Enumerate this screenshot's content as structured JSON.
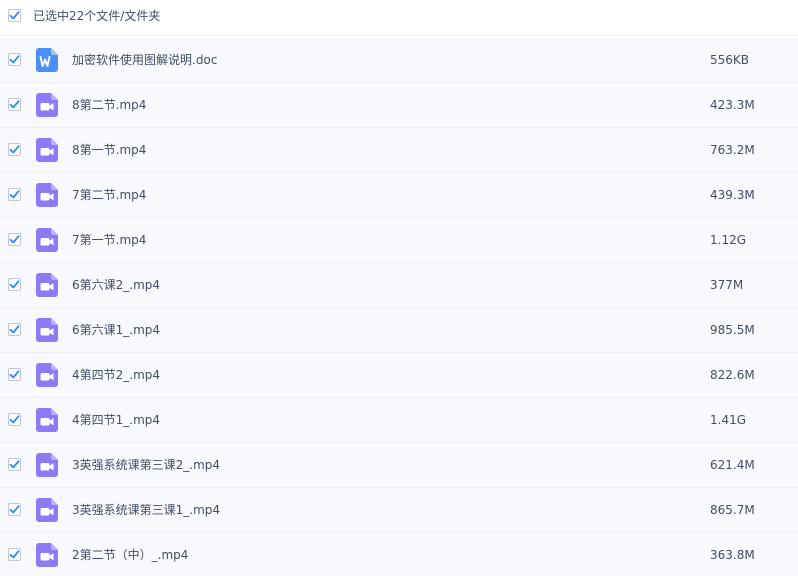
{
  "header": {
    "selection_text": "已选中22个文件/文件夹",
    "checked": true
  },
  "colors": {
    "check_blue": "#2d8cf0",
    "doc_icon_blue": "#4a8ff5",
    "video_icon_purple": "#8b7cf6",
    "row_bg": "#f7f9fc",
    "divider": "#e9eef5",
    "text": "#424e67"
  },
  "files": [
    {
      "name": "加密软件使用图解说明.doc",
      "size": "556KB",
      "icon": "word-doc-icon",
      "checked": true
    },
    {
      "name": "8第二节.mp4",
      "size": "423.3M",
      "icon": "video-file-icon",
      "checked": true
    },
    {
      "name": "8第一节.mp4",
      "size": "763.2M",
      "icon": "video-file-icon",
      "checked": true
    },
    {
      "name": "7第二节.mp4",
      "size": "439.3M",
      "icon": "video-file-icon",
      "checked": true
    },
    {
      "name": "7第一节.mp4",
      "size": "1.12G",
      "icon": "video-file-icon",
      "checked": true
    },
    {
      "name": "6第六课2_.mp4",
      "size": "377M",
      "icon": "video-file-icon",
      "checked": true
    },
    {
      "name": "6第六课1_.mp4",
      "size": "985.5M",
      "icon": "video-file-icon",
      "checked": true
    },
    {
      "name": "4第四节2_.mp4",
      "size": "822.6M",
      "icon": "video-file-icon",
      "checked": true
    },
    {
      "name": "4第四节1_.mp4",
      "size": "1.41G",
      "icon": "video-file-icon",
      "checked": true
    },
    {
      "name": "3英强系统课第三课2_.mp4",
      "size": "621.4M",
      "icon": "video-file-icon",
      "checked": true
    },
    {
      "name": "3英强系统课第三课1_.mp4",
      "size": "865.7M",
      "icon": "video-file-icon",
      "checked": true
    },
    {
      "name": "2第二节（中）_.mp4",
      "size": "363.8M",
      "icon": "video-file-icon",
      "checked": true
    }
  ]
}
